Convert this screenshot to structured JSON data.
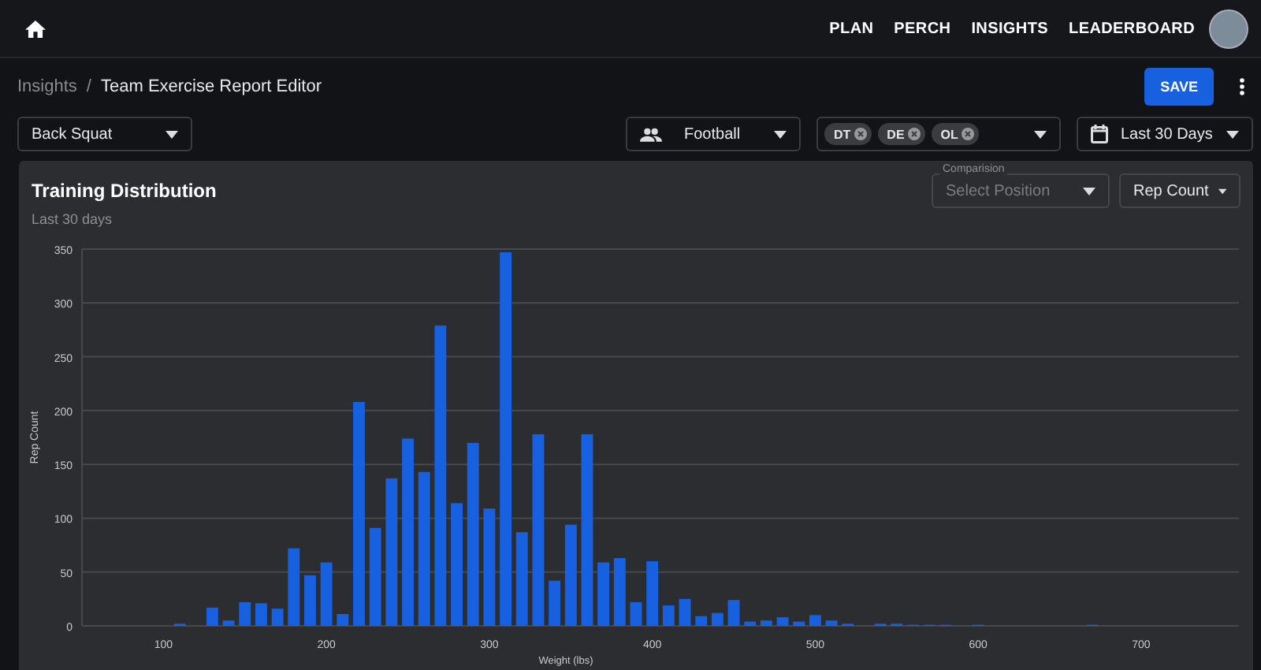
{
  "nav": {
    "items": [
      "PLAN",
      "PERCH",
      "INSIGHTS",
      "LEADERBOARD"
    ]
  },
  "breadcrumb": {
    "parent": "Insights",
    "separator": "/",
    "current": "Team Exercise Report Editor"
  },
  "save_label": "SAVE",
  "filters": {
    "exercise": "Back Squat",
    "sport": "Football",
    "positions": [
      "DT",
      "DE",
      "OL"
    ],
    "date_range": "Last 30 Days"
  },
  "card": {
    "title": "Training Distribution",
    "subtitle": "Last 30 days",
    "comparison": {
      "label": "Comparision",
      "placeholder": "Select Position"
    },
    "metric": "Rep Count",
    "chart_data": {
      "type": "bar",
      "xlabel": "Weight (lbs)",
      "ylabel": "Rep Count",
      "xlim": [
        50,
        760
      ],
      "ylim": [
        0,
        350
      ],
      "xticks": [
        100,
        200,
        300,
        400,
        500,
        600,
        700
      ],
      "yticks": [
        0,
        50,
        100,
        150,
        200,
        250,
        300,
        350
      ],
      "x": [
        110,
        120,
        130,
        140,
        150,
        160,
        170,
        180,
        190,
        200,
        210,
        220,
        230,
        240,
        250,
        260,
        270,
        280,
        290,
        300,
        310,
        320,
        330,
        340,
        350,
        360,
        370,
        380,
        390,
        400,
        410,
        420,
        430,
        440,
        450,
        460,
        470,
        480,
        490,
        500,
        510,
        520,
        530,
        540,
        550,
        560,
        570,
        580,
        590,
        600,
        610,
        620,
        630,
        640,
        650,
        660,
        670
      ],
      "grid": true,
      "values": [
        2,
        0,
        17,
        5,
        22,
        21,
        16,
        72,
        47,
        59,
        11,
        208,
        91,
        137,
        174,
        143,
        279,
        114,
        170,
        109,
        347,
        87,
        178,
        42,
        94,
        178,
        59,
        63,
        22,
        60,
        19,
        25,
        9,
        12,
        24,
        4,
        5,
        8,
        4,
        10,
        5,
        2,
        0,
        2,
        2,
        1,
        1,
        1,
        0,
        1,
        0,
        0,
        0,
        0,
        0,
        0,
        1
      ]
    }
  }
}
